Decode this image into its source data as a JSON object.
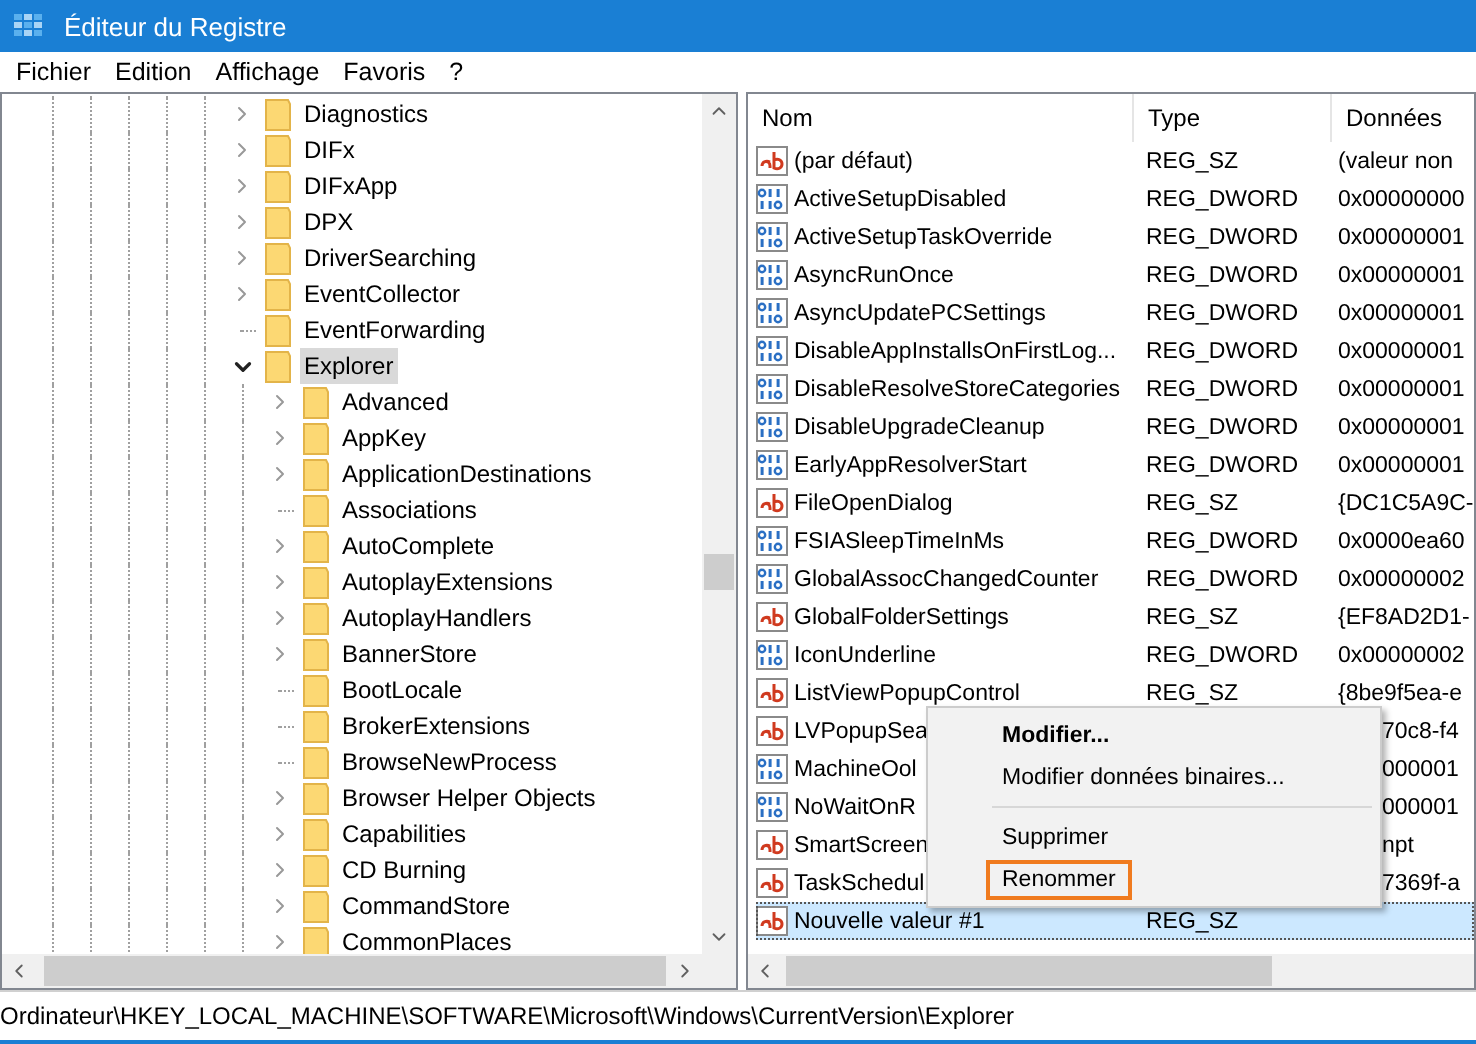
{
  "window": {
    "title": "Éditeur du Registre"
  },
  "menu": [
    "Fichier",
    "Edition",
    "Affichage",
    "Favoris",
    "?"
  ],
  "tree": [
    {
      "label": "Diagnostics",
      "kind": "node",
      "expanded": false,
      "selected": false
    },
    {
      "label": "DIFx",
      "kind": "node",
      "expanded": false,
      "selected": false
    },
    {
      "label": "DIFxApp",
      "kind": "node",
      "expanded": false,
      "selected": false
    },
    {
      "label": "DPX",
      "kind": "node",
      "expanded": false,
      "selected": false
    },
    {
      "label": "DriverSearching",
      "kind": "node",
      "expanded": false,
      "selected": false
    },
    {
      "label": "EventCollector",
      "kind": "node",
      "expanded": false,
      "selected": false
    },
    {
      "label": "EventForwarding",
      "kind": "leaf",
      "selected": false
    },
    {
      "label": "Explorer",
      "kind": "node",
      "expanded": true,
      "selected": true,
      "children": [
        {
          "label": "Advanced",
          "kind": "node",
          "expanded": false,
          "selected": false
        },
        {
          "label": "AppKey",
          "kind": "node",
          "expanded": false,
          "selected": false
        },
        {
          "label": "ApplicationDestinations",
          "kind": "node",
          "expanded": false,
          "selected": false
        },
        {
          "label": "Associations",
          "kind": "leaf",
          "selected": false
        },
        {
          "label": "AutoComplete",
          "kind": "node",
          "expanded": false,
          "selected": false
        },
        {
          "label": "AutoplayExtensions",
          "kind": "node",
          "expanded": false,
          "selected": false
        },
        {
          "label": "AutoplayHandlers",
          "kind": "node",
          "expanded": false,
          "selected": false
        },
        {
          "label": "BannerStore",
          "kind": "node",
          "expanded": false,
          "selected": false
        },
        {
          "label": "BootLocale",
          "kind": "leaf",
          "selected": false
        },
        {
          "label": "BrokerExtensions",
          "kind": "leaf",
          "selected": false
        },
        {
          "label": "BrowseNewProcess",
          "kind": "leaf",
          "selected": false
        },
        {
          "label": "Browser Helper Objects",
          "kind": "node",
          "expanded": false,
          "selected": false
        },
        {
          "label": "Capabilities",
          "kind": "node",
          "expanded": false,
          "selected": false
        },
        {
          "label": "CD Burning",
          "kind": "node",
          "expanded": false,
          "selected": false
        },
        {
          "label": "CommandStore",
          "kind": "node",
          "expanded": false,
          "selected": false
        },
        {
          "label": "CommonPlaces",
          "kind": "node",
          "expanded": false,
          "selected": false
        }
      ]
    }
  ],
  "values": {
    "columns": [
      "Nom",
      "Type",
      "Données"
    ],
    "rows": [
      {
        "kind": "sz",
        "name": "(par défaut)",
        "type": "REG_SZ",
        "data": "(valeur non",
        "selected": false
      },
      {
        "kind": "dword",
        "name": "ActiveSetupDisabled",
        "type": "REG_DWORD",
        "data": "0x00000000",
        "selected": false
      },
      {
        "kind": "dword",
        "name": "ActiveSetupTaskOverride",
        "type": "REG_DWORD",
        "data": "0x00000001",
        "selected": false
      },
      {
        "kind": "dword",
        "name": "AsyncRunOnce",
        "type": "REG_DWORD",
        "data": "0x00000001",
        "selected": false
      },
      {
        "kind": "dword",
        "name": "AsyncUpdatePCSettings",
        "type": "REG_DWORD",
        "data": "0x00000001",
        "selected": false
      },
      {
        "kind": "dword",
        "name": "DisableAppInstallsOnFirstLog...",
        "type": "REG_DWORD",
        "data": "0x00000001",
        "selected": false
      },
      {
        "kind": "dword",
        "name": "DisableResolveStoreCategories",
        "type": "REG_DWORD",
        "data": "0x00000001",
        "selected": false
      },
      {
        "kind": "dword",
        "name": "DisableUpgradeCleanup",
        "type": "REG_DWORD",
        "data": "0x00000001",
        "selected": false
      },
      {
        "kind": "dword",
        "name": "EarlyAppResolverStart",
        "type": "REG_DWORD",
        "data": "0x00000001",
        "selected": false
      },
      {
        "kind": "sz",
        "name": "FileOpenDialog",
        "type": "REG_SZ",
        "data": "{DC1C5A9C-",
        "selected": false
      },
      {
        "kind": "dword",
        "name": "FSIASleepTimeInMs",
        "type": "REG_DWORD",
        "data": "0x0000ea60",
        "selected": false
      },
      {
        "kind": "dword",
        "name": "GlobalAssocChangedCounter",
        "type": "REG_DWORD",
        "data": "0x00000002",
        "selected": false
      },
      {
        "kind": "sz",
        "name": "GlobalFolderSettings",
        "type": "REG_SZ",
        "data": "{EF8AD2D1-",
        "selected": false
      },
      {
        "kind": "dword",
        "name": "IconUnderline",
        "type": "REG_DWORD",
        "data": "0x00000002",
        "selected": false
      },
      {
        "kind": "sz",
        "name": "ListViewPopupControl",
        "type": "REG_SZ",
        "data": "{8be9f5ea-e",
        "selected": false
      },
      {
        "kind": "sz",
        "name": "LVPopupSea",
        "data": "70c8-f4",
        "selected": false
      },
      {
        "kind": "dword",
        "name": "MachineOol",
        "data": "000001",
        "selected": false
      },
      {
        "kind": "dword",
        "name": "NoWaitOnR",
        "data": "000001",
        "selected": false
      },
      {
        "kind": "sz",
        "name": "SmartScreen",
        "data": "npt",
        "selected": false
      },
      {
        "kind": "sz",
        "name": "TaskSchedul",
        "data": "7369f-a",
        "selected": false
      },
      {
        "kind": "sz",
        "name": "Nouvelle valeur #1",
        "type": "REG_SZ",
        "selected": true
      }
    ]
  },
  "context_menu": [
    {
      "kind": "item",
      "label": "Modifier...",
      "default": true,
      "highlighted": false
    },
    {
      "kind": "item",
      "label": "Modifier données binaires...",
      "default": false,
      "highlighted": false
    },
    {
      "kind": "separator"
    },
    {
      "kind": "item",
      "label": "Supprimer",
      "default": false,
      "highlighted": false
    },
    {
      "kind": "item",
      "label": "Renommer",
      "default": false,
      "highlighted": true
    }
  ],
  "status_bar": "Ordinateur\\HKEY_LOCAL_MACHINE\\SOFTWARE\\Microsoft\\Windows\\CurrentVersion\\Explorer"
}
